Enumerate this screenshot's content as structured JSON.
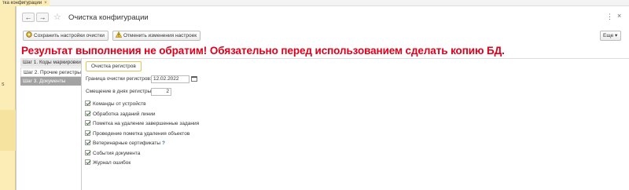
{
  "os_tab": {
    "label": "тка конфигурации",
    "close": "×"
  },
  "side_mark": "s",
  "window": {
    "title": "Очистка конфигурации",
    "back": "←",
    "forward": "→",
    "favorite": "☆",
    "more_dots": "⋮",
    "close": "×"
  },
  "toolbar": {
    "save_settings": "Сохранить настройки очистки",
    "cancel_changes": "Отменить изменения настроек",
    "more": "Еще",
    "more_arrow": "▾"
  },
  "warning": "Результат выполнения не обратим! Обязательно перед использованием сделать копию БД.",
  "steps": [
    {
      "label": "Шаг 1. Коды маркировки"
    },
    {
      "label": "Шаг 2. Прочие регистры"
    },
    {
      "label": "Шаг 3. Документы"
    }
  ],
  "content": {
    "run_button": "Очистка регистров",
    "border_label": "Граница очистки регистров:",
    "border_value": "12.02.2022",
    "offset_label": "Смещение в днях регистры:",
    "offset_value": "2",
    "checkboxes": [
      {
        "label": "Команды от устройств",
        "checked": true
      },
      {
        "label": "Обработка заданий линии",
        "checked": true
      },
      {
        "label": "Пометка на удаление завершенные задания",
        "checked": true
      },
      {
        "label": "Проведение пометка удаления объектов",
        "checked": true
      },
      {
        "label": "Ветеринарные сертификаты",
        "checked": true,
        "help": "?"
      },
      {
        "label": "События документа",
        "checked": true
      },
      {
        "label": "Журнал ошибок",
        "checked": true
      }
    ]
  },
  "colors": {
    "warning": "#e0001b",
    "tab_accent": "#fbedb5",
    "run_border": "#e2c25b"
  }
}
